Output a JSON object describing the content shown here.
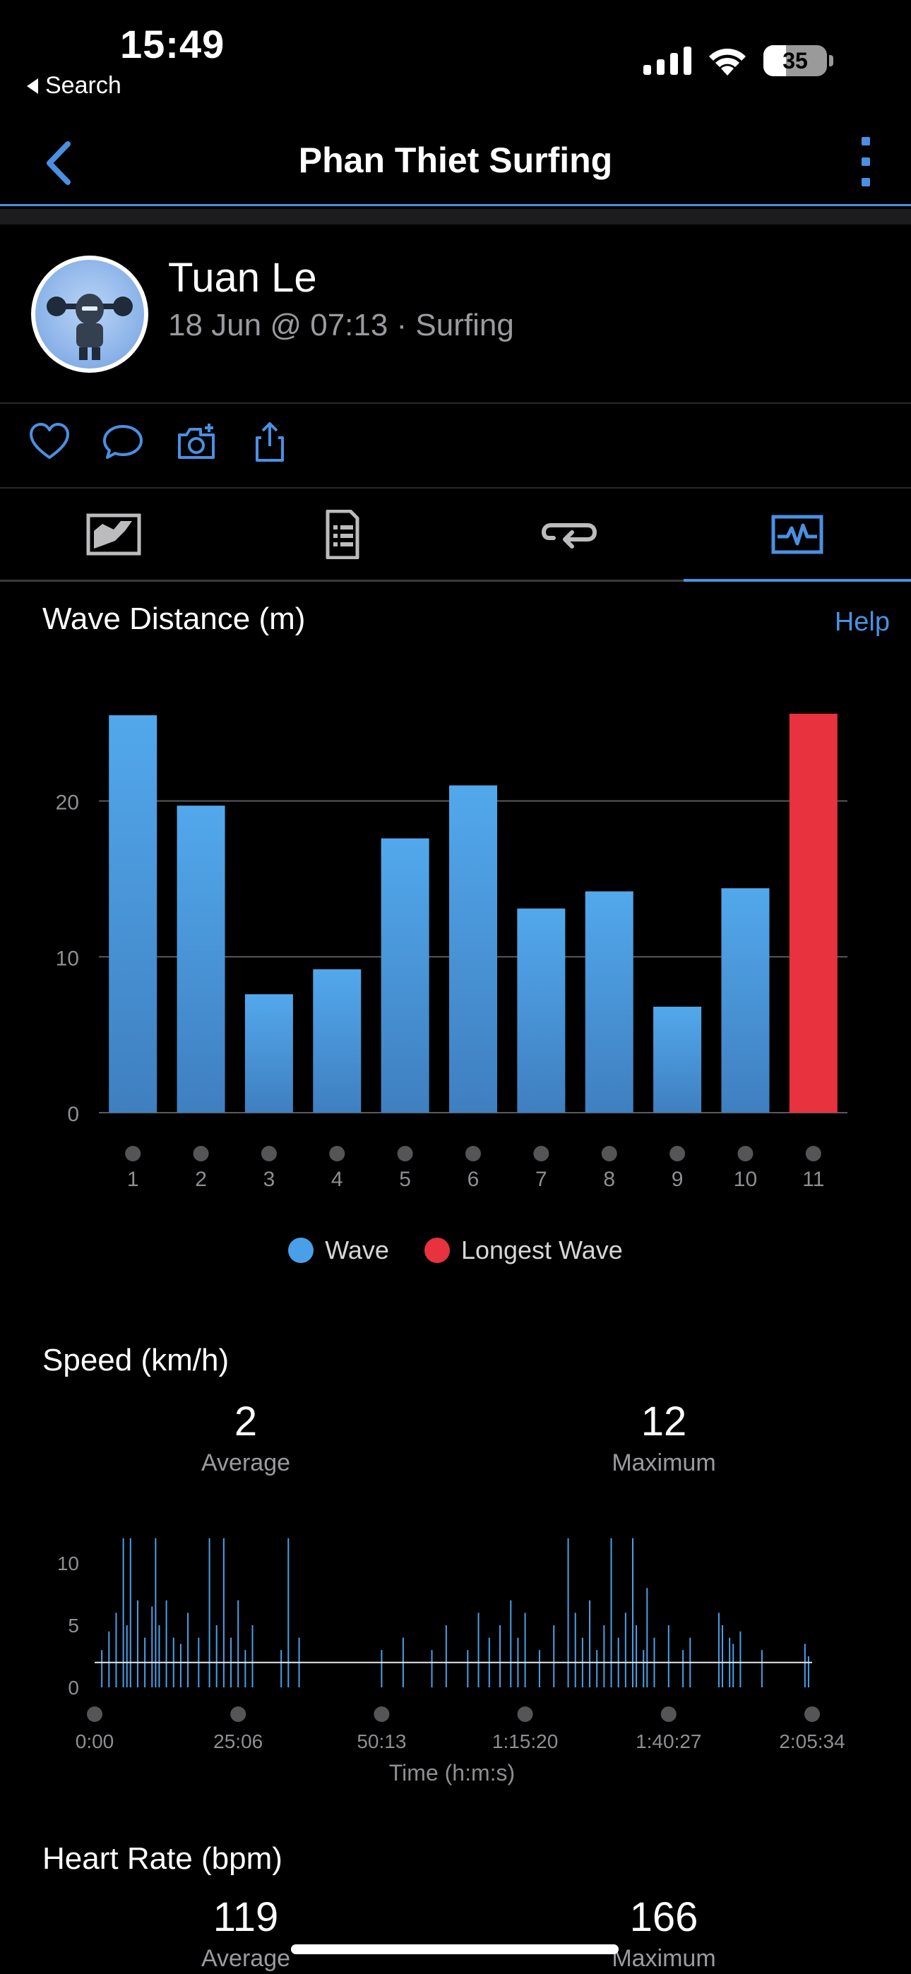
{
  "status": {
    "time": "15:49",
    "back_label": "Search",
    "battery": "35"
  },
  "nav": {
    "title": "Phan Thiet Surfing"
  },
  "activity": {
    "user": "Tuan Le",
    "meta": "18 Jun @ 07:13 · Surfing"
  },
  "wave": {
    "title": "Wave Distance (m)",
    "help": "Help",
    "legend": [
      {
        "label": "Wave",
        "color": "#4aa0e8"
      },
      {
        "label": "Longest Wave",
        "color": "#e8323e"
      }
    ]
  },
  "chart_data": [
    {
      "type": "bar",
      "categories": [
        "1",
        "2",
        "3",
        "4",
        "5",
        "6",
        "7",
        "8",
        "9",
        "10",
        "11"
      ],
      "values": [
        25.5,
        19.7,
        7.6,
        9.2,
        17.6,
        21.0,
        13.1,
        14.2,
        6.8,
        14.4,
        25.6
      ],
      "highlight_index": 10,
      "colors": {
        "bar": "#4aa0e8",
        "highlight": "#e8323e",
        "grid": "#5a5a5e",
        "tick": "#8e8e93"
      },
      "ylim": [
        0,
        27
      ],
      "yticks": [
        0,
        10,
        20
      ]
    },
    {
      "type": "line",
      "ylim": [
        0,
        12.5
      ],
      "yticks": [
        0,
        5,
        10
      ],
      "xtick_labels": [
        "0:00",
        "25:06",
        "50:13",
        "1:15:20",
        "1:40:27",
        "2:05:34"
      ],
      "xlabel": "Time (h:m:s)",
      "baseline": 2,
      "colors": {
        "line": "#4aa0e8",
        "baseline": "#e8e8ea"
      }
    }
  ],
  "speed": {
    "title": "Speed (km/h)",
    "average": "2",
    "average_label": "Average",
    "maximum": "12",
    "maximum_label": "Maximum"
  },
  "heart": {
    "title": "Heart Rate (bpm)",
    "average": "119",
    "average_label": "Average",
    "maximum": "166",
    "maximum_label": "Maximum"
  }
}
